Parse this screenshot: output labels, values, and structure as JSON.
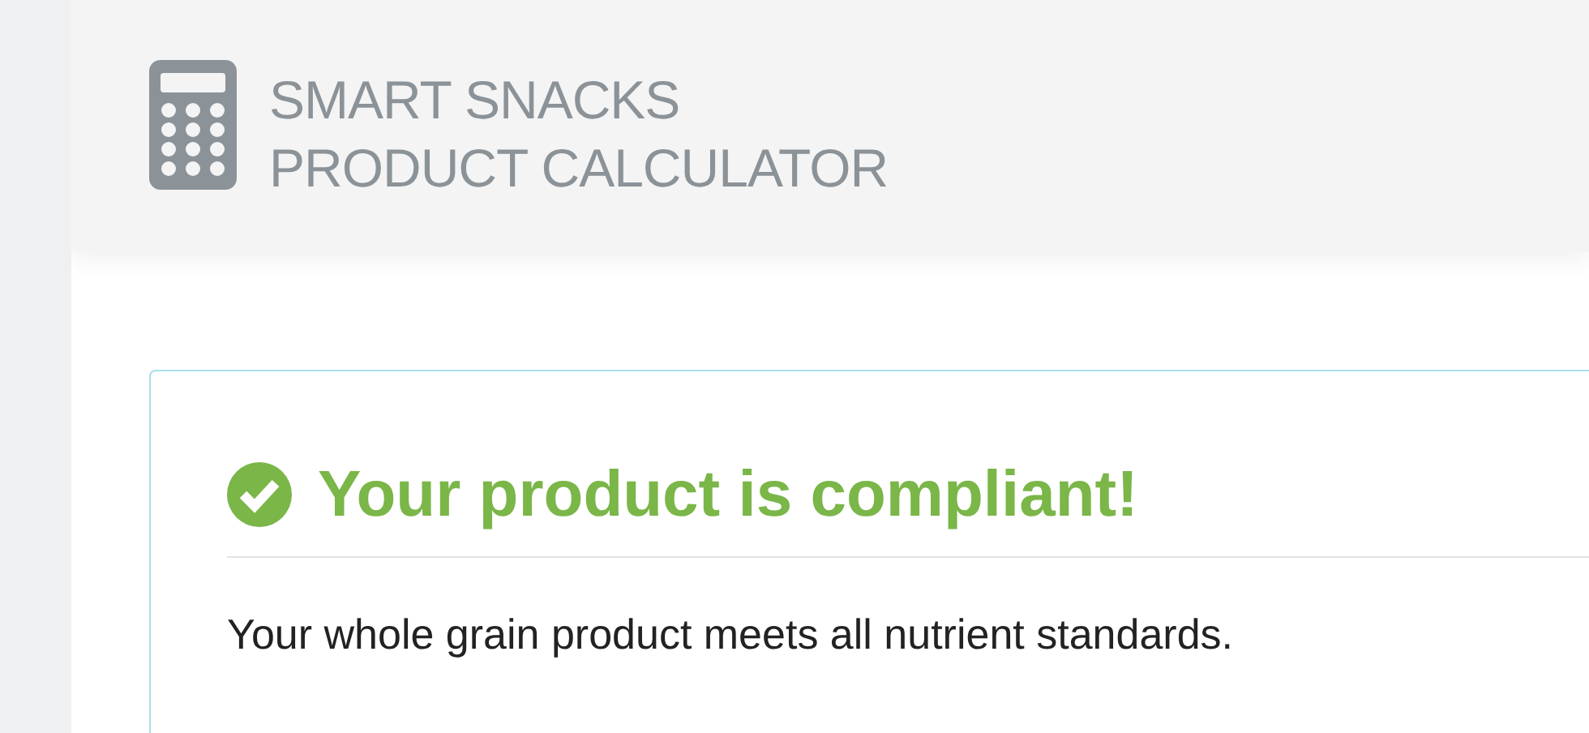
{
  "header": {
    "title_lines": [
      "SMART SNACKS",
      "PRODUCT CALCULATOR"
    ]
  },
  "result": {
    "compliant": true,
    "heading": "Your product is compliant!",
    "message": "Your whole grain product meets all nutrient standards."
  }
}
